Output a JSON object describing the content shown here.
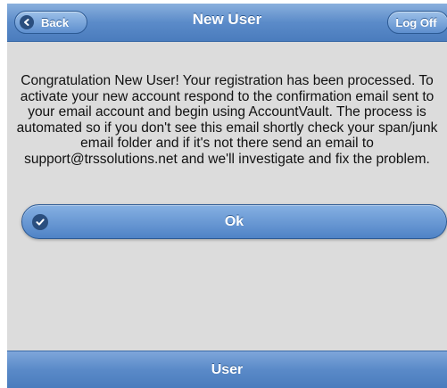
{
  "header": {
    "title": "New User",
    "back_label": "Back",
    "logoff_label": "Log Off"
  },
  "main": {
    "message": "Congratulation New User! Your registration has been processed. To activate your new account respond to the confirmation email sent to your email account and begin using AccountVault. The process is automated so if you don't see this email shortly check your span/junk email folder and if it's not there send an email to support@trssolutions.net and we'll investigate and fix the problem.",
    "ok_label": "Ok"
  },
  "footer": {
    "label": "User"
  },
  "colors": {
    "accent": "#5b8bc9",
    "background": "#dcdcdc"
  },
  "icons": {
    "back": "back-arrow-icon",
    "ok": "checkmark-icon"
  }
}
